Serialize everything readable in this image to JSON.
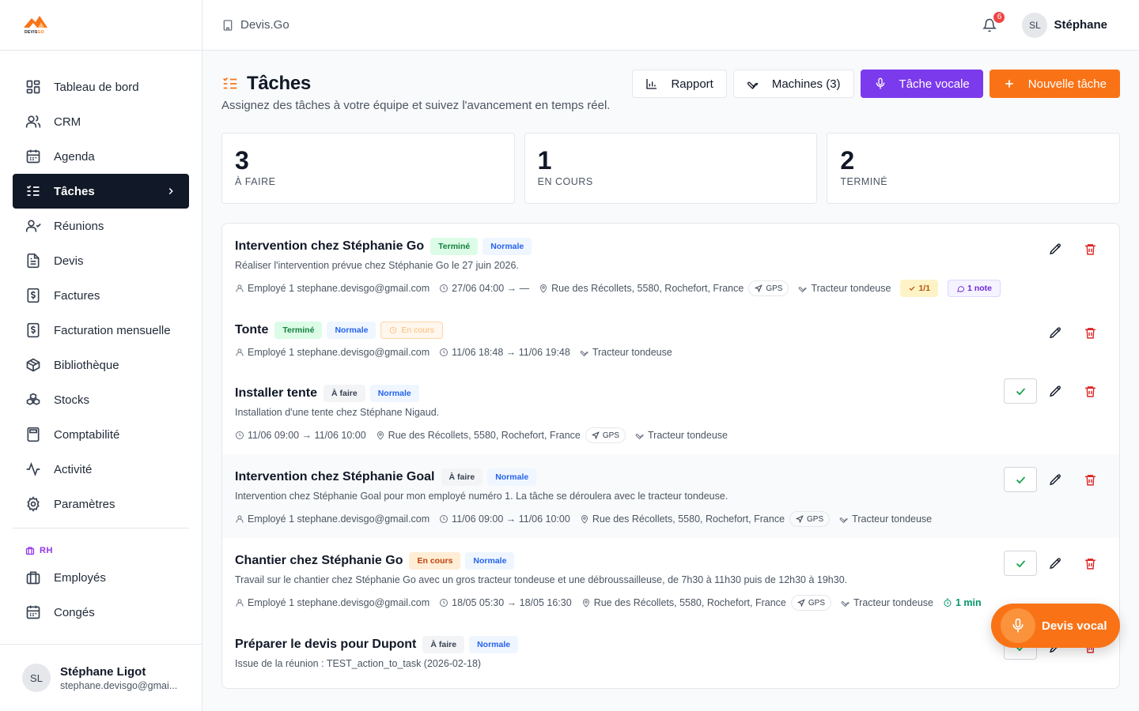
{
  "brand": {
    "logo_text_a": "DEVIS",
    "logo_text_b": "GO"
  },
  "sidebar": {
    "items": [
      {
        "label": "Tableau de bord",
        "icon": "dashboard-icon"
      },
      {
        "label": "CRM",
        "icon": "users-icon"
      },
      {
        "label": "Agenda",
        "icon": "calendar-icon"
      },
      {
        "label": "Tâches",
        "icon": "list-check-icon",
        "active": true
      },
      {
        "label": "Réunions",
        "icon": "meeting-icon"
      },
      {
        "label": "Devis",
        "icon": "document-icon"
      },
      {
        "label": "Factures",
        "icon": "invoice-icon"
      },
      {
        "label": "Facturation mensuelle",
        "icon": "monthly-billing-icon"
      },
      {
        "label": "Bibliothèque",
        "icon": "box-icon"
      },
      {
        "label": "Stocks",
        "icon": "boxes-icon"
      },
      {
        "label": "Comptabilité",
        "icon": "calculator-icon"
      },
      {
        "label": "Activité",
        "icon": "activity-icon"
      },
      {
        "label": "Paramètres",
        "icon": "gear-icon"
      }
    ],
    "section_rh": "RH",
    "rh_items": [
      {
        "label": "Employés",
        "icon": "building-icon"
      },
      {
        "label": "Congés",
        "icon": "calendar-icon"
      }
    ],
    "user": {
      "initials": "SL",
      "name": "Stéphane Ligot",
      "email": "stephane.devisgo@gmai..."
    }
  },
  "topbar": {
    "breadcrumb": "Devis.Go",
    "notif_count": "6",
    "user_initials": "SL",
    "user_name": "Stéphane"
  },
  "page": {
    "title": "Tâches",
    "subtitle": "Assignez des tâches à votre équipe et suivez l'avancement en temps réel.",
    "actions": {
      "report": "Rapport",
      "machines": "Machines (3)",
      "voice_task": "Tâche vocale",
      "new_task": "Nouvelle tâche"
    }
  },
  "stats": [
    {
      "value": "3",
      "label": "À FAIRE"
    },
    {
      "value": "1",
      "label": "EN COURS"
    },
    {
      "value": "2",
      "label": "TERMINÉ"
    }
  ],
  "tasks": [
    {
      "title": "Intervention chez Stéphanie Go",
      "status": "Terminé",
      "priority": "Normale",
      "description": "Réaliser l'intervention prévue chez Stéphanie Go le 27 juin 2026.",
      "employee": "Employé 1 stephane.devisgo@gmail.com",
      "time": "27/06 04:00 → —",
      "address": "Rue des Récollets, 5580, Rochefort, France",
      "gps": "GPS",
      "machine": "Tracteur tondeuse",
      "checklist": "1/1",
      "notes": "1 note"
    },
    {
      "title": "Tonte",
      "status": "Terminé",
      "priority": "Normale",
      "extra_tag": "En cours",
      "employee": "Employé 1 stephane.devisgo@gmail.com",
      "time": "11/06 18:48 → 11/06 19:48",
      "machine": "Tracteur tondeuse"
    },
    {
      "title": "Installer tente",
      "status": "À faire",
      "priority": "Normale",
      "description": "Installation d'une tente chez Stéphane Nigaud.",
      "time": "11/06 09:00 → 11/06 10:00",
      "address": "Rue des Récollets, 5580, Rochefort, France",
      "gps": "GPS",
      "machine": "Tracteur tondeuse"
    },
    {
      "title": "Intervention chez Stéphanie Goal",
      "status": "À faire",
      "priority": "Normale",
      "description": "Intervention chez Stéphanie Goal pour mon employé numéro 1. La tâche se déroulera avec le tracteur tondeuse.",
      "employee": "Employé 1 stephane.devisgo@gmail.com",
      "time": "11/06 09:00 → 11/06 10:00",
      "address": "Rue des Récollets, 5580, Rochefort, France",
      "gps": "GPS",
      "machine": "Tracteur tondeuse"
    },
    {
      "title": "Chantier chez Stéphanie Go",
      "status": "En cours",
      "priority": "Normale",
      "description": "Travail sur le chantier chez Stéphanie Go avec un gros tracteur tondeuse et une débroussailleuse, de 7h30 à 11h30 puis de 12h30 à 19h30.",
      "employee": "Employé 1 stephane.devisgo@gmail.com",
      "time": "18/05 05:30 → 18/05 16:30",
      "address": "Rue des Récollets, 5580, Rochefort, France",
      "gps": "GPS",
      "machine": "Tracteur tondeuse",
      "duration": "1 min"
    },
    {
      "title": "Préparer le devis pour Dupont",
      "status": "À faire",
      "priority": "Normale",
      "description": "Issue de la réunion : TEST_action_to_task (2026-02-18)"
    }
  ],
  "fab": {
    "label": "Devis vocal"
  },
  "colors": {
    "accent": "#f97316",
    "violet": "#7c3aed",
    "sidebar_active": "#111827",
    "danger": "#dc2626",
    "success": "#16a34a"
  }
}
